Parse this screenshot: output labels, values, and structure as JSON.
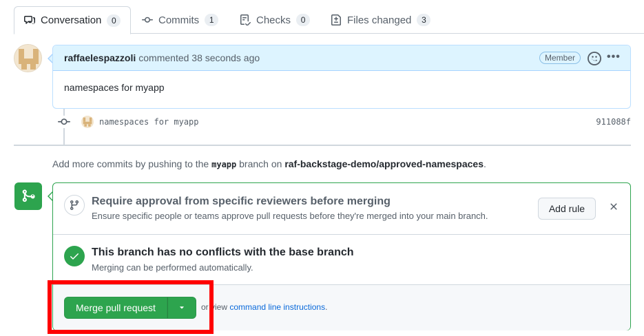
{
  "tabs": [
    {
      "label": "Conversation",
      "count": "0",
      "icon": "comment-discussion-icon"
    },
    {
      "label": "Commits",
      "count": "1",
      "icon": "commit-icon"
    },
    {
      "label": "Checks",
      "count": "0",
      "icon": "checklist-icon"
    },
    {
      "label": "Files changed",
      "count": "3",
      "icon": "file-diff-icon"
    }
  ],
  "comment": {
    "author": "raffaelespazzoli",
    "meta": "commented 38 seconds ago",
    "badge": "Member",
    "body": "namespaces for myapp"
  },
  "commit": {
    "message": "namespaces for myapp",
    "sha": "911088f"
  },
  "push_note": {
    "prefix": "Add more commits by pushing to the",
    "branch": "myapp",
    "middle": "branch on",
    "repo": "raf-backstage-demo/approved-namespaces",
    "suffix": "."
  },
  "merge": {
    "rule_title": "Require approval from specific reviewers before merging",
    "rule_sub": "Ensure specific people or teams approve pull requests before they're merged into your main branch.",
    "add_rule_label": "Add rule",
    "conflict_title": "This branch has no conflicts with the base branch",
    "conflict_sub": "Merging can be performed automatically.",
    "merge_button_label": "Merge pull request",
    "alt_prefix": "or view",
    "alt_link": "command line instructions",
    "alt_suffix": "."
  },
  "colors": {
    "success": "#2da44e",
    "link": "#0969da",
    "highlight": "#ff0000",
    "comment_header_bg": "#ddf4ff"
  }
}
